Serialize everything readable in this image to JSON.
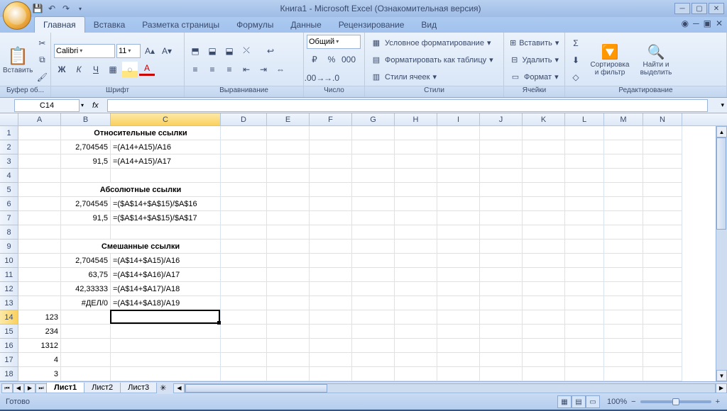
{
  "title": "Книга1 - Microsoft Excel (Ознакомительная версия)",
  "tabs": {
    "items": [
      "Главная",
      "Вставка",
      "Разметка страницы",
      "Формулы",
      "Данные",
      "Рецензирование",
      "Вид"
    ],
    "active": 0
  },
  "ribbon": {
    "clipboard": {
      "label": "Буфер об...",
      "paste": "Вставить"
    },
    "font": {
      "label": "Шрифт",
      "name": "Calibri",
      "size": "11",
      "bold": "Ж",
      "italic": "К",
      "underline": "Ч"
    },
    "align": {
      "label": "Выравнивание"
    },
    "number": {
      "label": "Число",
      "format": "Общий"
    },
    "styles": {
      "label": "Стили",
      "conditional": "Условное форматирование",
      "as_table": "Форматировать как таблицу",
      "cell_styles": "Стили ячеек"
    },
    "cells": {
      "label": "Ячейки",
      "insert": "Вставить",
      "delete": "Удалить",
      "format": "Формат"
    },
    "editing": {
      "label": "Редактирование",
      "sort": "Сортировка и фильтр",
      "find": "Найти и выделить"
    }
  },
  "name_box": "C14",
  "columns": [
    {
      "n": "A",
      "w": 60
    },
    {
      "n": "B",
      "w": 70
    },
    {
      "n": "C",
      "w": 155
    },
    {
      "n": "D",
      "w": 65
    },
    {
      "n": "E",
      "w": 60
    },
    {
      "n": "F",
      "w": 60
    },
    {
      "n": "G",
      "w": 60
    },
    {
      "n": "H",
      "w": 60
    },
    {
      "n": "I",
      "w": 60
    },
    {
      "n": "J",
      "w": 60
    },
    {
      "n": "K",
      "w": 60
    },
    {
      "n": "L",
      "w": 55
    },
    {
      "n": "M",
      "w": 55
    },
    {
      "n": "N",
      "w": 55
    }
  ],
  "cells": {
    "B1": {
      "v": "Относительные ссылки",
      "bold": true,
      "span": 2
    },
    "B2": {
      "v": "2,704545",
      "a": "r"
    },
    "C2": {
      "v": "=(A14+A15)/A16"
    },
    "B3": {
      "v": "91,5",
      "a": "r"
    },
    "C3": {
      "v": "=(A14+A15)/A17"
    },
    "B5": {
      "v": "Абсолютные ссылки",
      "bold": true,
      "span": 2
    },
    "B6": {
      "v": "2,704545",
      "a": "r"
    },
    "C6": {
      "v": "=($A$14+$A$15)/$A$16"
    },
    "B7": {
      "v": "91,5",
      "a": "r"
    },
    "C7": {
      "v": "=($A$14+$A$15)/$A$17"
    },
    "B9": {
      "v": "Смешанные ссылки",
      "bold": true,
      "span": 2
    },
    "B10": {
      "v": "2,704545",
      "a": "r"
    },
    "C10": {
      "v": "=(A$14+$A15)/A16"
    },
    "B11": {
      "v": "63,75",
      "a": "r"
    },
    "C11": {
      "v": "=(A$14+$A16)/A17"
    },
    "B12": {
      "v": "42,33333",
      "a": "r"
    },
    "C12": {
      "v": "=(A$14+$A17)/A18"
    },
    "B13": {
      "v": "#ДЕЛ/0",
      "a": "r"
    },
    "C13": {
      "v": "=(A$14+$A18)/A19"
    },
    "A14": {
      "v": "123",
      "a": "r"
    },
    "A15": {
      "v": "234",
      "a": "r"
    },
    "A16": {
      "v": "1312",
      "a": "r"
    },
    "A17": {
      "v": "4",
      "a": "r"
    },
    "A18": {
      "v": "3",
      "a": "r"
    }
  },
  "row_count": 18,
  "selection": {
    "col": "C",
    "row": 14
  },
  "sheets": {
    "items": [
      "Лист1",
      "Лист2",
      "Лист3"
    ],
    "active": 0
  },
  "status": {
    "ready": "Готово",
    "zoom": "100%"
  }
}
